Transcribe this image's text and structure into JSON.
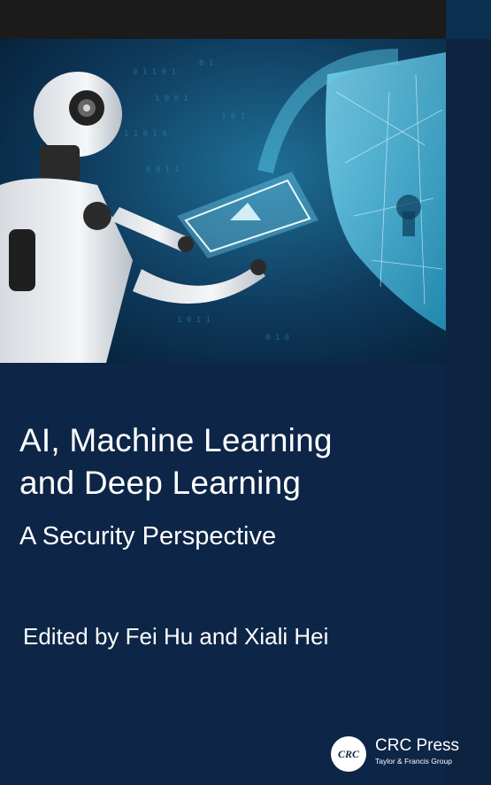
{
  "book": {
    "title_line1": "AI, Machine Learning",
    "title_line2": "and Deep Learning",
    "subtitle": "A Security Perspective",
    "editors": "Edited by Fei Hu and Xiali Hei"
  },
  "publisher": {
    "logo_text": "CRC",
    "name": "CRC Press",
    "group": "Taylor & Francis Group"
  },
  "colors": {
    "cover_background": "#0d2547",
    "accent_cyan": "#4fd3f0",
    "top_band": "#1b1b1b"
  },
  "icons": {
    "robot": "robot-illustration",
    "shield": "security-shield-icon",
    "tablet": "holographic-tablet"
  }
}
